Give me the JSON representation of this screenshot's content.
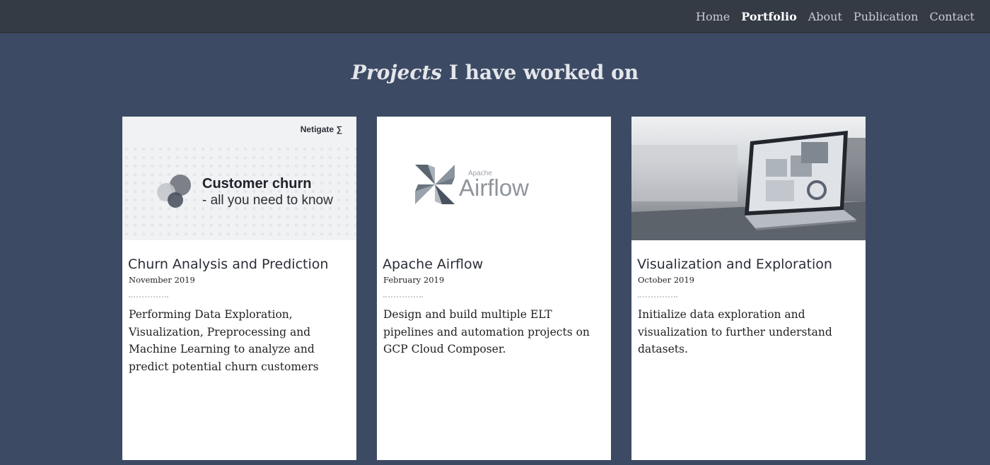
{
  "nav": {
    "links": [
      "Home",
      "Portfolio",
      "About",
      "Publication",
      "Contact"
    ],
    "active": "Portfolio"
  },
  "heading": {
    "emphasis": "Projects",
    "rest": " I have worked on"
  },
  "projects": [
    {
      "title": "Churn Analysis and Prediction",
      "date": "November 2019",
      "description": "Performing Data Exploration, Visualization, Preprocessing and Machine Learning to analyze and predict potential churn customers",
      "image": {
        "logo": "Netigate",
        "headline": "Customer churn",
        "subline": "- all you need to know"
      }
    },
    {
      "title": "Apache Airflow",
      "date": "February 2019",
      "description": "Design and build multiple ELT pipelines and automation projects on GCP Cloud Composer.",
      "image": {
        "small": "Apache",
        "big": "Airflow"
      }
    },
    {
      "title": "Visualization and Exploration",
      "date": "October 2019",
      "description": "Initialize data exploration and visualization to further understand datasets.",
      "image": {}
    }
  ],
  "colors": {
    "page_bg": "#3c4a64",
    "nav_bg": "#353b45",
    "card_bg": "#ffffff"
  }
}
